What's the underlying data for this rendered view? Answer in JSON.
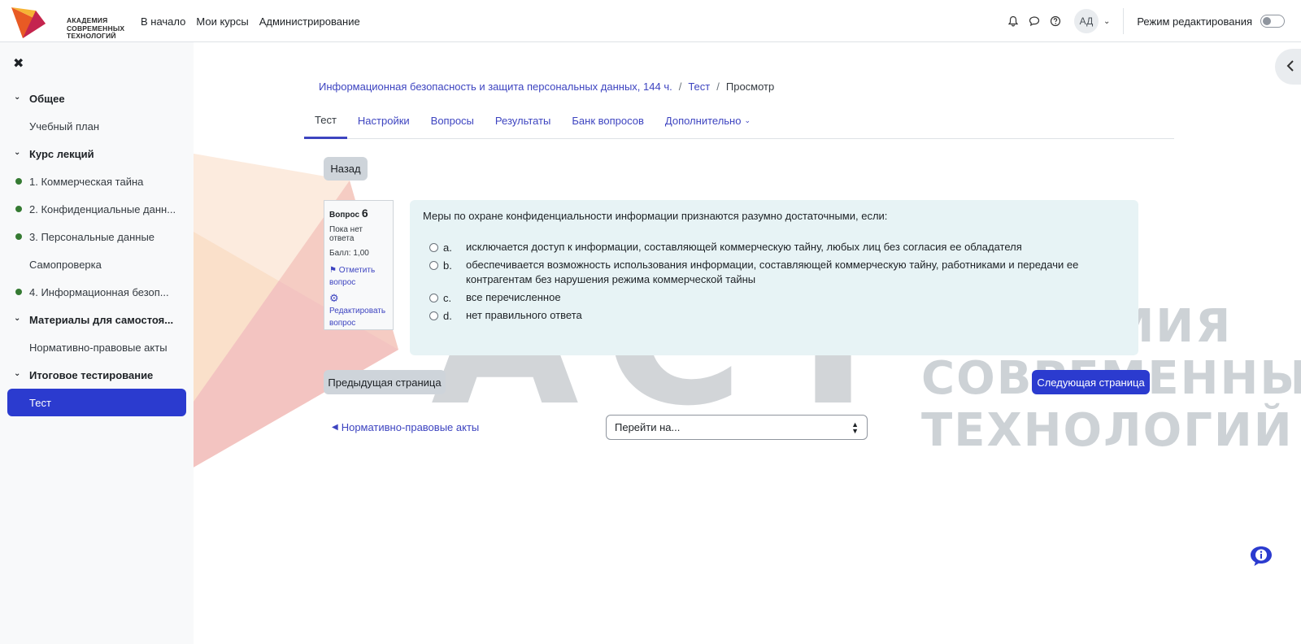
{
  "brand": {
    "logo_text": "АКАДЕМИЯ\nСОВРЕМЕННЫХ\nТЕХНОЛОГИЙ",
    "watermark_letters": "АСТ",
    "watermark_text": "АКАДЕМИЯ\nСОВРЕМЕННЫХ\nТЕХНОЛОГИЙ",
    "accent_color": "#2b3bcf",
    "logo_colors": [
      "#e85a24",
      "#f6b335",
      "#c4244f"
    ]
  },
  "navbar": {
    "links": [
      "В начало",
      "Мои курсы",
      "Администрирование"
    ],
    "icons": [
      "bell-icon",
      "chat-icon",
      "help-circle-icon"
    ],
    "avatar_initials": "АД",
    "edit_mode_label": "Режим редактирования"
  },
  "course_index": {
    "sections": [
      {
        "title": "Общее",
        "items": [
          {
            "label": "Учебный план",
            "completed": false
          }
        ]
      },
      {
        "title": "Курс лекций",
        "items": [
          {
            "label": "1. Коммерческая тайна",
            "completed": true
          },
          {
            "label": "2. Конфиденциальные данн...",
            "completed": true
          },
          {
            "label": "3. Персональные данные",
            "completed": true
          },
          {
            "label": "Самопроверка",
            "completed": false
          },
          {
            "label": "4. Информационная безоп...",
            "completed": true
          }
        ]
      },
      {
        "title": "Материалы для самостоя...",
        "items": [
          {
            "label": "Нормативно-правовые акты",
            "completed": false
          }
        ]
      },
      {
        "title": "Итоговое тестирование",
        "items": [
          {
            "label": "Тест",
            "completed": false,
            "active": true
          }
        ]
      }
    ]
  },
  "breadcrumb": {
    "course": "Информационная безопасность и защита персональных данных, 144 ч.",
    "activity": "Тест",
    "current": "Просмотр",
    "separator": "/"
  },
  "tabs": {
    "items": [
      "Тест",
      "Настройки",
      "Вопросы",
      "Результаты",
      "Банк вопросов",
      "Дополнительно"
    ],
    "active": "Тест"
  },
  "back_button": "Назад",
  "question": {
    "label": "Вопрос",
    "number": "6",
    "status": "Пока нет ответа",
    "score": "Балл: 1,00",
    "flag_label": "Отметить вопрос",
    "edit_label": "Редактировать вопрос",
    "text": "Меры по охране конфиденциальности информации признаются разумно достаточными, если:",
    "answers": [
      {
        "letter": "a.",
        "text": "исключается доступ к информации, составляющей коммерческую тайну, любых лиц без согласия ее обладателя"
      },
      {
        "letter": "b.",
        "text": "обеспечивается возможность использования информации, составляющей коммерческую тайну, работниками и передачи ее контрагентам без нарушения режима коммерческой тайны"
      },
      {
        "letter": "c.",
        "text": "все перечисленное"
      },
      {
        "letter": "d.",
        "text": "нет правильного ответа"
      }
    ]
  },
  "pagination": {
    "prev": "Предыдущая страница",
    "next": "Следующая страница"
  },
  "activity_nav": {
    "prev_link": "Нормативно-правовые акты",
    "jump_placeholder": "Перейти на..."
  },
  "close_icon": "close-icon"
}
